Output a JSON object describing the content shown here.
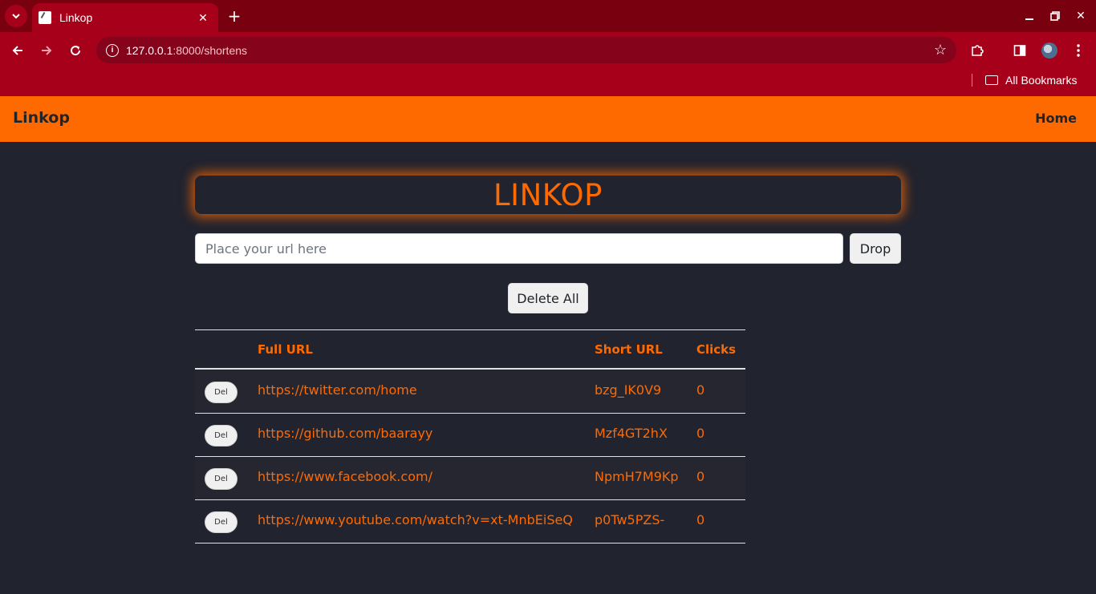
{
  "browser": {
    "tab_title": "Linkop",
    "url_host": "127.0.0.1",
    "url_rest": ":8000/shortens",
    "bookmarks_label": "All Bookmarks"
  },
  "navbar": {
    "brand": "Linkop",
    "home_link": "Home"
  },
  "main": {
    "hero_title": "LINKOP",
    "url_placeholder": "Place your url here",
    "drop_button": "Drop",
    "delete_all_button": "Delete All"
  },
  "table": {
    "headers": [
      "",
      "Full URL",
      "Short URL",
      "Clicks"
    ],
    "rows": [
      {
        "del": "Del",
        "full_url": "https://twitter.com/home",
        "short_url": "bzg_IK0V9",
        "clicks": "0"
      },
      {
        "del": "Del",
        "full_url": "https://github.com/baarayy",
        "short_url": "Mzf4GT2hX",
        "clicks": "0"
      },
      {
        "del": "Del",
        "full_url": "https://www.facebook.com/",
        "short_url": "NpmH7M9Kp",
        "clicks": "0"
      },
      {
        "del": "Del",
        "full_url": "https://www.youtube.com/watch?v=xt-MnbEiSeQ",
        "short_url": "p0Tw5PZS-",
        "clicks": "0"
      }
    ]
  },
  "colors": {
    "accent": "#ff6a00",
    "page_bg": "#21232e",
    "browser_frame": "#a7001a"
  }
}
